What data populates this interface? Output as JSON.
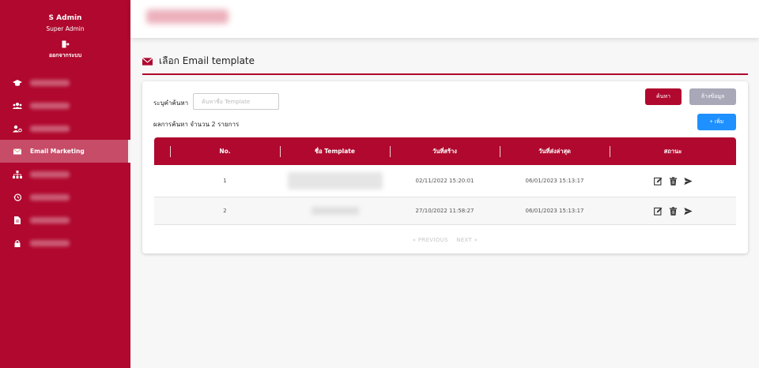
{
  "sidebar": {
    "user_name": "S Admin",
    "user_role": "Super Admin",
    "logout_label": "ออกจากระบบ",
    "items": [
      {
        "icon": "graduation-cap-icon",
        "label": ""
      },
      {
        "icon": "users-icon",
        "label": ""
      },
      {
        "icon": "user-cog-icon",
        "label": ""
      },
      {
        "icon": "envelope-icon",
        "label": "Email Marketing"
      },
      {
        "icon": "sitemap-icon",
        "label": ""
      },
      {
        "icon": "history-icon",
        "label": ""
      },
      {
        "icon": "file-icon",
        "label": ""
      },
      {
        "icon": "lock-icon",
        "label": ""
      }
    ]
  },
  "page": {
    "title": "เลือก Email template"
  },
  "search": {
    "label": "ระบุคำค้นหา",
    "placeholder": "ค้นหาชื่อ Template",
    "value": "",
    "search_button": "ค้นหา",
    "clear_button": "ล้างข้อมูล",
    "add_button": "+ เพิ่ม",
    "result_text": "ผลการค้นหา จำนวน 2 รายการ"
  },
  "table": {
    "headers": [
      "No.",
      "ชื่อ Template",
      "วันที่สร้าง",
      "วันที่ส่งล่าสุด",
      "สถานะ"
    ],
    "rows": [
      {
        "no": "1",
        "name": "",
        "created": "02/11/2022 15:20:01",
        "last_sent": "06/01/2023 15:13:17"
      },
      {
        "no": "2",
        "name": "",
        "created": "27/10/2022 11:58:27",
        "last_sent": "06/01/2023 15:13:17"
      }
    ]
  },
  "pager": {
    "previous": "« PREVIOUS",
    "next": "NEXT »"
  },
  "colors": {
    "brand": "#b0082e",
    "add_button": "#1e90ff",
    "clear_button": "#a8a8b8"
  }
}
